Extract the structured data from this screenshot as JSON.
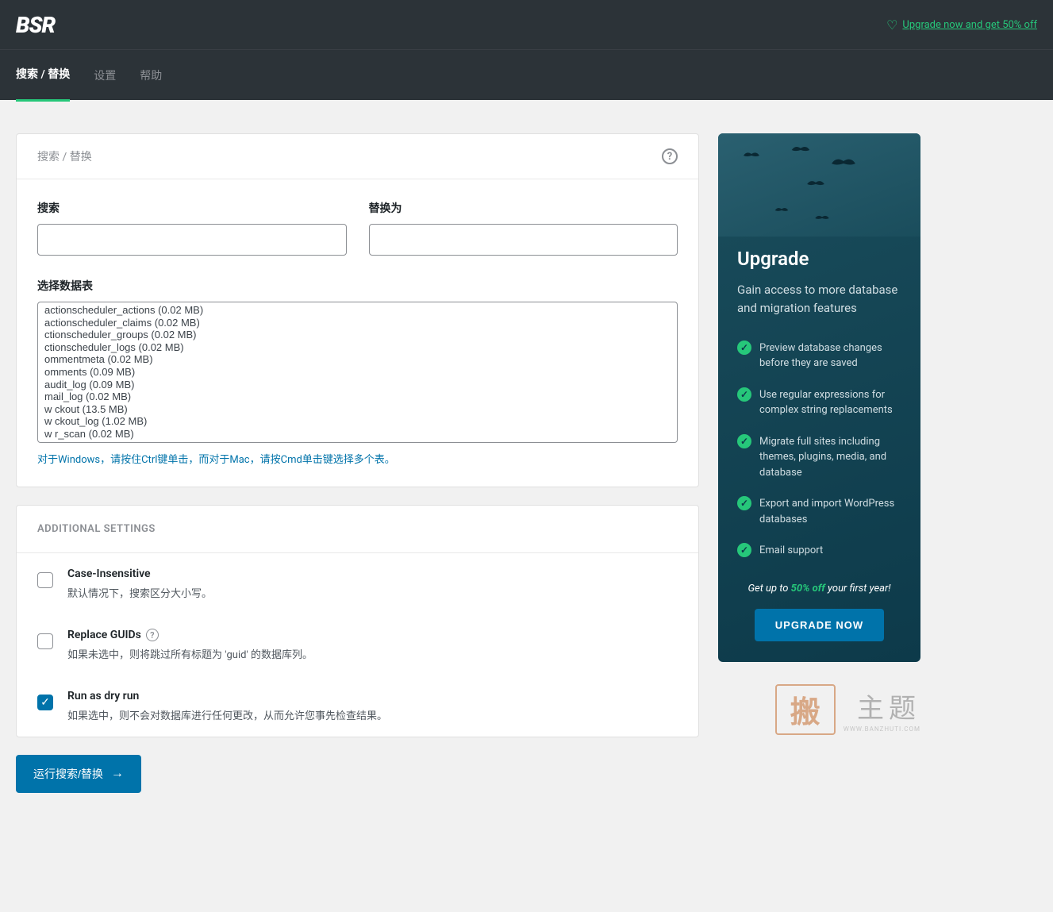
{
  "header": {
    "logo": "BSR",
    "upgrade_link": "Upgrade now and get 50% off"
  },
  "nav": {
    "tabs": [
      {
        "label": "搜索 / 替换",
        "active": true
      },
      {
        "label": "设置",
        "active": false
      },
      {
        "label": "帮助",
        "active": false
      }
    ]
  },
  "search_panel": {
    "title": "搜索 / 替换",
    "search_label": "搜索",
    "replace_label": "替换为",
    "select_label": "选择数据表",
    "tables": [
      "actionscheduler_actions (0.02 MB)",
      "actionscheduler_claims (0.02 MB)",
      "ctionscheduler_groups (0.02 MB)",
      "ctionscheduler_logs (0.02 MB)",
      "ommentmeta (0.02 MB)",
      "omments (0.09 MB)",
      "audit_log (0.09 MB)",
      "mail_log (0.02 MB)",
      "ckout (13.5 MB)",
      "ckout_log (1.02 MB)",
      "r_scan (0.02 MB)"
    ],
    "prefix_partial": [
      "",
      "",
      "",
      "",
      "",
      "",
      "",
      "",
      "w",
      "w",
      "w"
    ],
    "hint": "对于Windows，请按住Ctrl键单击，而对于Mac，请按Cmd单击键选择多个表。"
  },
  "additional": {
    "heading": "ADDITIONAL SETTINGS",
    "items": [
      {
        "title": "Case-Insensitive",
        "desc": "默认情况下，搜索区分大小写。",
        "checked": false,
        "info": false
      },
      {
        "title": "Replace GUIDs",
        "desc": "如果未选中，则将跳过所有标题为 'guid' 的数据库列。",
        "checked": false,
        "info": true
      },
      {
        "title": "Run as dry run",
        "desc": "如果选中，则不会对数据库进行任何更改，从而允许您事先检查结果。",
        "checked": true,
        "info": false
      }
    ]
  },
  "run_button": "运行搜索/替换",
  "upgrade_card": {
    "heading": "Upgrade",
    "sub": "Gain access to more database and migration features",
    "features": [
      "Preview database changes before they are saved",
      "Use regular expressions for complex string replacements",
      "Migrate full sites including themes, plugins, media, and database",
      "Export and import WordPress databases",
      "Email support"
    ],
    "promo_pre": "Get up to ",
    "promo_pct": "50% off",
    "promo_post": " your first year!",
    "button": "UPGRADE NOW"
  },
  "watermark": {
    "seal": "搬",
    "text": "主题",
    "sub": "WWW.BANZHUTI.COM"
  }
}
